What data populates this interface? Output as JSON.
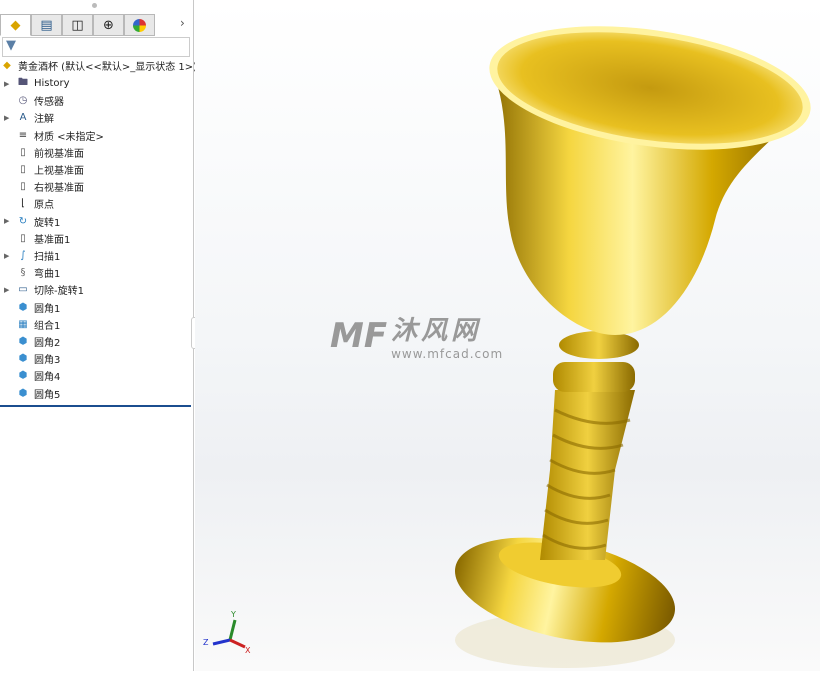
{
  "tabs": [
    "feature-manager",
    "property-manager",
    "configuration-manager",
    "dimxpert-manager",
    "display-manager"
  ],
  "tree": {
    "root": "黄金酒杯  (默认<<默认>_显示状态 1>)",
    "items": [
      {
        "label": "History",
        "icon": "history-folder-icon",
        "expandable": true
      },
      {
        "label": "传感器",
        "icon": "sensor-folder-icon",
        "expandable": false
      },
      {
        "label": "注解",
        "icon": "annotation-folder-icon",
        "expandable": true
      },
      {
        "label": "材质 <未指定>",
        "icon": "material-icon",
        "expandable": false
      },
      {
        "label": "前视基准面",
        "icon": "plane-icon",
        "expandable": false
      },
      {
        "label": "上视基准面",
        "icon": "plane-icon",
        "expandable": false
      },
      {
        "label": "右视基准面",
        "icon": "plane-icon",
        "expandable": false
      },
      {
        "label": "原点",
        "icon": "origin-icon",
        "expandable": false
      },
      {
        "label": "旋转1",
        "icon": "revolve-icon",
        "expandable": true
      },
      {
        "label": "基准面1",
        "icon": "plane-icon",
        "expandable": false
      },
      {
        "label": "扫描1",
        "icon": "sweep-icon",
        "expandable": true
      },
      {
        "label": "弯曲1",
        "icon": "flex-icon",
        "expandable": false
      },
      {
        "label": "切除-旋转1",
        "icon": "cut-revolve-icon",
        "expandable": true
      },
      {
        "label": "圆角1",
        "icon": "fillet-icon",
        "expandable": false
      },
      {
        "label": "组合1",
        "icon": "combine-icon",
        "expandable": false
      },
      {
        "label": "圆角2",
        "icon": "fillet-icon",
        "expandable": false
      },
      {
        "label": "圆角3",
        "icon": "fillet-icon",
        "expandable": false
      },
      {
        "label": "圆角4",
        "icon": "fillet-icon",
        "expandable": false
      },
      {
        "label": "圆角5",
        "icon": "fillet-icon",
        "expandable": false
      }
    ]
  },
  "watermark": {
    "name": "沐风网",
    "url": "www.mfcad.com"
  },
  "triad": {
    "x": "X",
    "y": "Y",
    "z": "Z"
  },
  "colors": {
    "gold": "#e8c020",
    "accent": "#1b4e8f"
  }
}
